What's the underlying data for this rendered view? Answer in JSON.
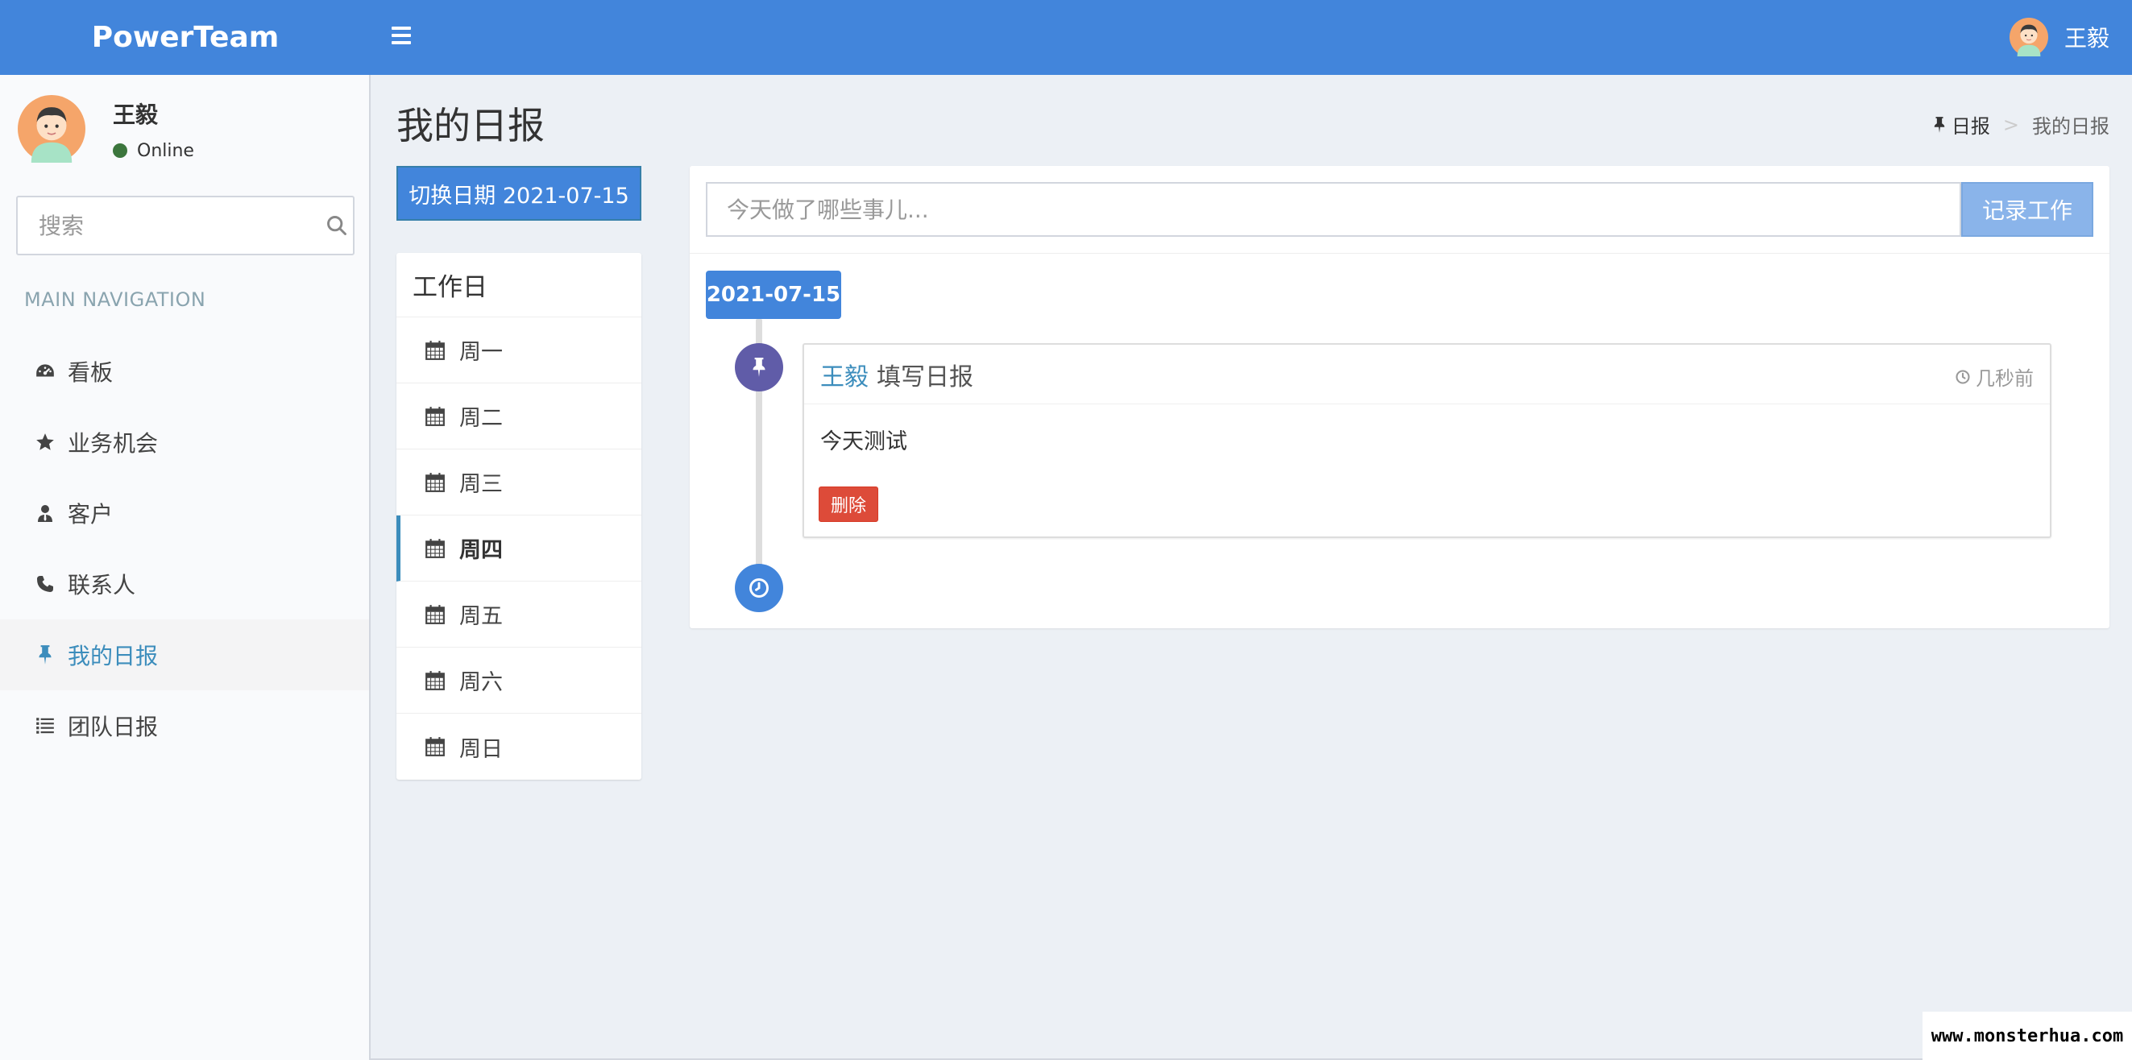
{
  "app": {
    "logo": "PowerTeam"
  },
  "topbar": {
    "user_name": "王毅"
  },
  "sidebar": {
    "user_name": "王毅",
    "status": "Online",
    "search_placeholder": "搜索",
    "nav_header": "MAIN NAVIGATION",
    "items": [
      {
        "label": "看板",
        "icon": "dashboard-icon"
      },
      {
        "label": "业务机会",
        "icon": "star-icon"
      },
      {
        "label": "客户",
        "icon": "user-tie-icon"
      },
      {
        "label": "联系人",
        "icon": "phone-icon"
      },
      {
        "label": "我的日报",
        "icon": "pin-icon",
        "active": true
      },
      {
        "label": "团队日报",
        "icon": "list-icon"
      }
    ]
  },
  "page": {
    "title": "我的日报",
    "breadcrumb": {
      "home": "日报",
      "current": "我的日报"
    }
  },
  "date_switch": {
    "label": "切换日期 2021-07-15"
  },
  "workday": {
    "title": "工作日",
    "days": [
      "周一",
      "周二",
      "周三",
      "周四",
      "周五",
      "周六",
      "周日"
    ],
    "active_index": 3
  },
  "record": {
    "placeholder": "今天做了哪些事儿...",
    "button_label": "记录工作"
  },
  "timeline": {
    "date_label": "2021-07-15",
    "entry": {
      "author": "王毅",
      "action": "填写日报",
      "time": "几秒前",
      "body": "今天测试",
      "delete_label": "删除"
    }
  },
  "watermark": "www.monsterhua.com",
  "colors": {
    "primary": "#4285db",
    "sidebar_bg": "#f9fafc",
    "content_bg": "#ecf0f5",
    "active_link": "#3c8dbc",
    "danger": "#dd4b39",
    "purple": "#605ca8",
    "online": "#3c763d"
  }
}
